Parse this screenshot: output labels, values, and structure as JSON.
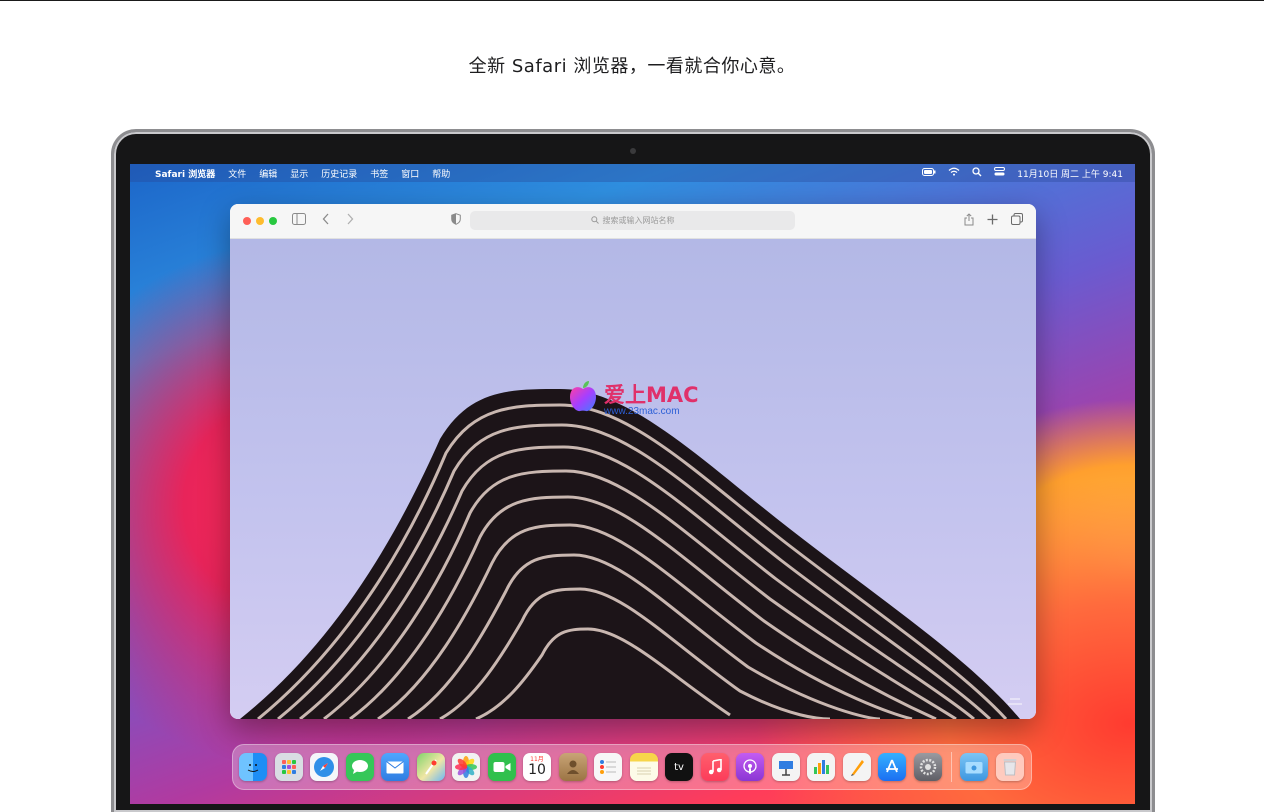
{
  "headline": "全新 Safari 浏览器，一看就合你心意。",
  "menubar": {
    "app_name": "Safari 浏览器",
    "menus": [
      "文件",
      "编辑",
      "显示",
      "历史记录",
      "书签",
      "窗口",
      "帮助"
    ],
    "clock": "11月10日 周二 上午 9:41",
    "status_icons": [
      "battery-icon",
      "wifi-icon",
      "spotlight-icon",
      "control-center-icon"
    ]
  },
  "browser": {
    "address_placeholder": "搜索或输入网站名称",
    "toolbar_icons": [
      "sidebar-icon",
      "back-icon",
      "forward-icon",
      "privacy-shield-icon",
      "share-icon",
      "new-tab-icon",
      "tabs-overview-icon"
    ]
  },
  "watermark": {
    "title": "爱上MAC",
    "url": "www.23mac.com"
  },
  "dock": {
    "calendar_month": "11月",
    "calendar_day": "10",
    "apps": [
      {
        "name": "finder",
        "color": "#1e8ef5"
      },
      {
        "name": "launchpad",
        "color": "#d9dde3"
      },
      {
        "name": "safari",
        "color": "#2f8fe8"
      },
      {
        "name": "messages",
        "color": "#35c759"
      },
      {
        "name": "mail",
        "color": "#2f7de1"
      },
      {
        "name": "maps",
        "color": "#57b65c"
      },
      {
        "name": "photos",
        "color": "#f2f2f2"
      },
      {
        "name": "facetime",
        "color": "#30c04d"
      },
      {
        "name": "calendar",
        "color": "#ffffff"
      },
      {
        "name": "contacts",
        "color": "#b08a5a"
      },
      {
        "name": "reminders",
        "color": "#f7f7f7"
      },
      {
        "name": "notes",
        "color": "#f7d54a"
      },
      {
        "name": "tv",
        "color": "#111111"
      },
      {
        "name": "music",
        "color": "#fc3c5a"
      },
      {
        "name": "podcasts",
        "color": "#a04ddb"
      },
      {
        "name": "keynote",
        "color": "#f4f4f4"
      },
      {
        "name": "numbers",
        "color": "#f4f4f4"
      },
      {
        "name": "pages",
        "color": "#f4f4f4"
      },
      {
        "name": "app-store",
        "color": "#1b8cf2"
      },
      {
        "name": "system-preferences",
        "color": "#8e8e93"
      }
    ],
    "tv_label": "tv"
  }
}
